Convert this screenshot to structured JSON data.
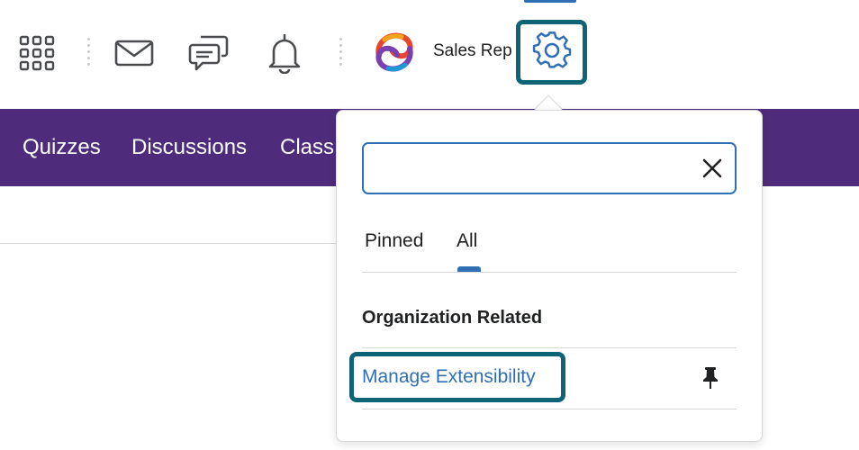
{
  "header": {
    "icons": [
      "apps-grid-icon",
      "mail-icon",
      "chat-icon",
      "bell-icon",
      "gear-icon"
    ],
    "user_name": "Sales Rep"
  },
  "nav": {
    "items": [
      {
        "label": "Quizzes"
      },
      {
        "label": "Discussions"
      },
      {
        "label": "Class"
      }
    ]
  },
  "dropdown": {
    "search": {
      "value": "",
      "placeholder": ""
    },
    "tabs": [
      {
        "label": "Pinned",
        "active": false
      },
      {
        "label": "All",
        "active": true
      }
    ],
    "section_title": "Organization Related",
    "items": [
      {
        "label": "Manage Extensibility",
        "icon": "pin-icon"
      }
    ]
  },
  "colors": {
    "accent": "#2f6fb5",
    "nav_bg": "#4f2c7b",
    "highlight": "#0e6377"
  }
}
